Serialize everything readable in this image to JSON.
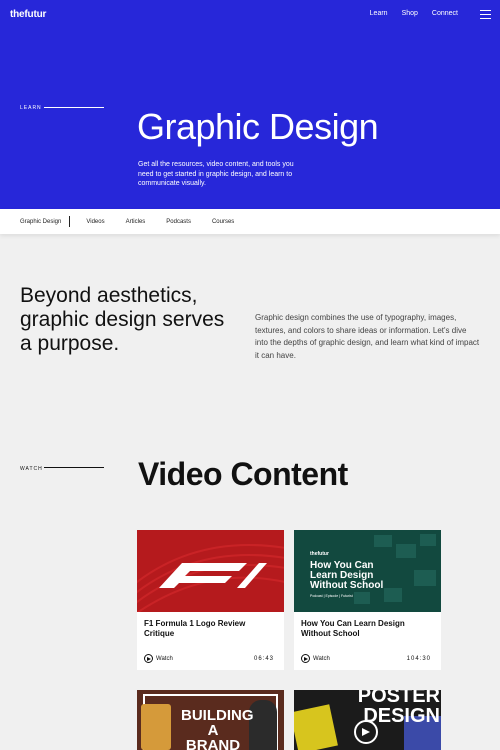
{
  "brand": {
    "logo": "thefutur"
  },
  "topnav": {
    "items": [
      "Learn",
      "Shop",
      "Connect"
    ]
  },
  "hero": {
    "eyebrow": "LEARN",
    "title": "Graphic Design",
    "description": "Get all the resources, video content, and tools you need to get started in graphic design, and learn to communicate visually."
  },
  "subnav": {
    "active": "Graphic Design",
    "items": [
      "Videos",
      "Articles",
      "Podcasts",
      "Courses"
    ]
  },
  "intro": {
    "heading": "Beyond aesthetics, graphic design serves a purpose.",
    "text": "Graphic design combines the use of typography, images, textures, and colors to share ideas or information. Let's dive into the depths of graphic design, and learn what kind of impact it can have."
  },
  "watch": {
    "eyebrow": "WATCH",
    "title": "Video Content",
    "cards": [
      {
        "title": "F1 Formula 1 Logo Review Critique",
        "watch_label": "Watch",
        "duration": "06:43"
      },
      {
        "title": "How You Can Learn Design Without School",
        "watch_label": "Watch",
        "duration": "104:30",
        "thumb_brand": "thefutur",
        "thumb_headline": "How You Can Learn Design Without School",
        "thumb_tag": "Podcast | Episode | Futurist"
      },
      {
        "thumb_text": "BUILDING A BRAND"
      },
      {
        "thumb_text": "POSTER DESIGN"
      }
    ]
  },
  "colors": {
    "hero_bg": "#2727d9",
    "card_bg": "#ffffff",
    "page_bg": "#f0f0f0"
  }
}
